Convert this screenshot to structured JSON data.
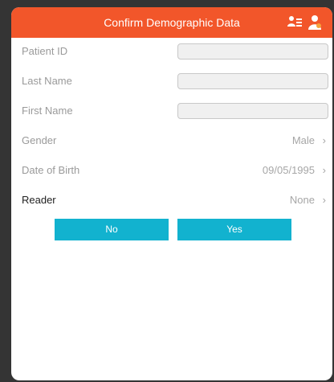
{
  "header": {
    "title": "Confirm Demographic Data",
    "icon_left": "patient-list-icon",
    "icon_right": "person-icon"
  },
  "form": {
    "patient_id": {
      "label": "Patient ID",
      "value": "",
      "placeholder": ""
    },
    "last_name": {
      "label": "Last Name",
      "value": "",
      "placeholder": ""
    },
    "first_name": {
      "label": "First Name",
      "value": "",
      "placeholder": ""
    },
    "gender": {
      "label": "Gender",
      "value": "Male"
    },
    "dob": {
      "label": "Date of Birth",
      "value": "09/05/1995"
    },
    "reader": {
      "label": "Reader",
      "value": "None"
    }
  },
  "buttons": {
    "no": "No",
    "yes": "Yes"
  },
  "colors": {
    "header": "#f2562a",
    "button": "#12b2cf"
  }
}
